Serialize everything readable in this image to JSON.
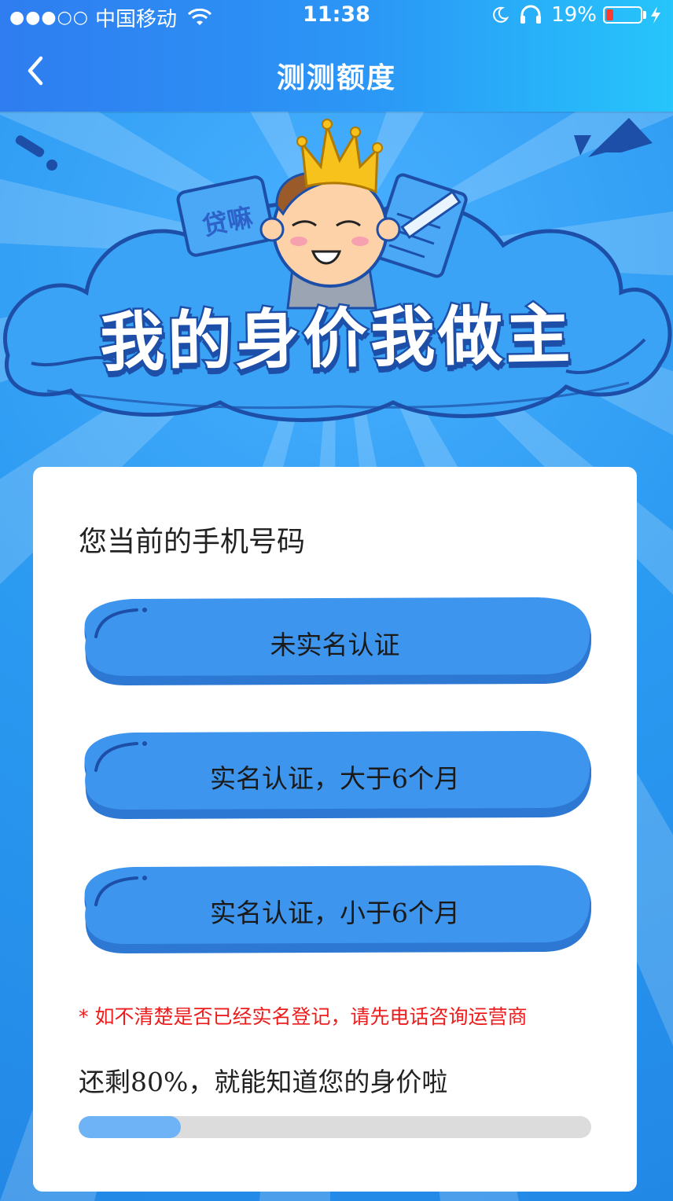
{
  "status_bar": {
    "signal": "●●●○○",
    "carrier": "中国移动",
    "time": "11:38",
    "battery_percent": "19%",
    "icons": [
      "wifi-icon",
      "moon-icon",
      "headphones-icon",
      "battery-icon",
      "charging-bolt-icon"
    ]
  },
  "nav": {
    "back_icon": "chevron-left-icon",
    "title": "测测额度"
  },
  "banner": {
    "title": "我的身价我做主",
    "tag_text": "贷嘛"
  },
  "card": {
    "heading": "您当前的手机号码",
    "options": [
      {
        "label": "未实名认证"
      },
      {
        "label": "实名认证，大于6个月"
      },
      {
        "label": "实名认证，小于6个月"
      }
    ],
    "notice": "* 如不清楚是否已经实名登记，请先电话咨询运营商",
    "progress_text": "还剩80%，就能知道您的身价啦",
    "progress_fraction": 0.2
  },
  "colors": {
    "nav_gradient_start": "#2f7df0",
    "nav_gradient_end": "#26c5fb",
    "button_blue": "#3e95ee",
    "button_shadow": "#2d78d3",
    "notice_red": "#ee1c1c",
    "progress_fill": "#6fb3f7",
    "progress_track": "#dcdcdc"
  }
}
